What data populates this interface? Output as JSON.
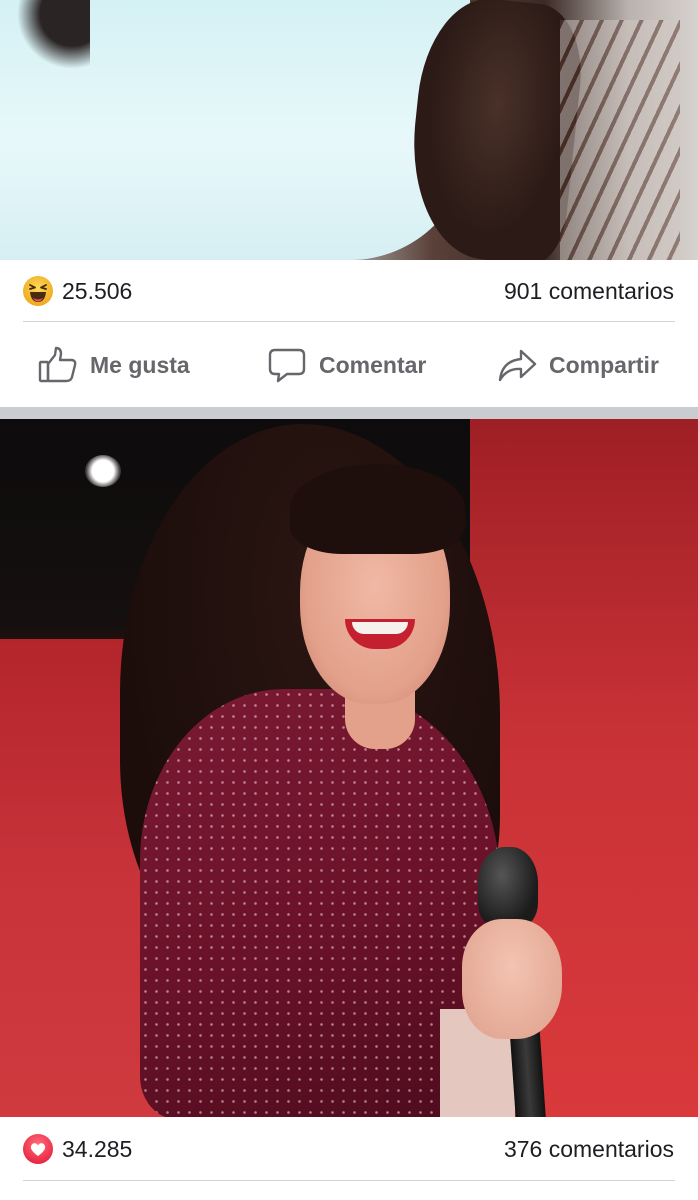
{
  "posts": [
    {
      "reaction_icon": "haha-reaction-icon",
      "reaction_count": "25.506",
      "comments": "901 comentarios"
    },
    {
      "reaction_icon": "love-reaction-icon",
      "reaction_count": "34.285",
      "comments": "376 comentarios"
    }
  ],
  "actions": {
    "like_label": "Me gusta",
    "comment_label": "Comentar",
    "share_label": "Compartir"
  },
  "colors": {
    "action_gray": "#65676b",
    "haha_yellow": "#f7b125",
    "love_red": "#f33e58",
    "separator": "#c9ccd1"
  }
}
